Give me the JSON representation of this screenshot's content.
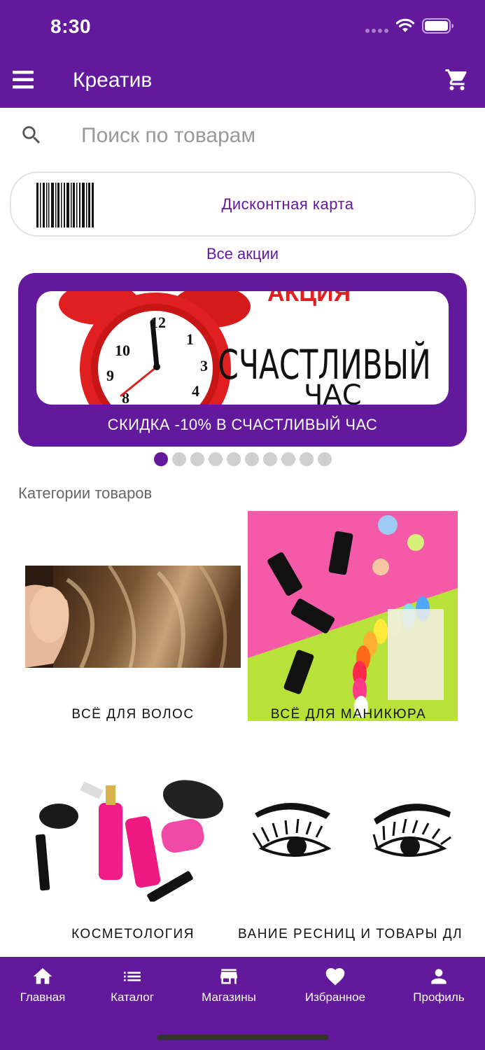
{
  "status_bar": {
    "time": "8:30"
  },
  "app_bar": {
    "title": "Креатив"
  },
  "search": {
    "placeholder": "Поиск по товарам"
  },
  "discount_card": {
    "label": "Дисконтная карта"
  },
  "promotions": {
    "all_link": "Все акции",
    "current": {
      "image_text_top": "АКЦИЯ",
      "image_text_line1": "СЧАСТЛИВЫЙ",
      "image_text_line2": "ЧАС",
      "caption": "СКИДКА -10% В СЧАСТЛИВЫЙ ЧАС"
    },
    "total_slides": 10,
    "active_slide": 1
  },
  "categories": {
    "title": "Категории товаров",
    "items": [
      {
        "label": "ВСЁ ДЛЯ ВОЛОС"
      },
      {
        "label": "ВСЁ ДЛЯ МАНИКЮРА"
      },
      {
        "label": "КОСМЕТОЛОГИЯ"
      },
      {
        "label": "ВАНИЕ РЕСНИЦ И ТОВАРЫ ДЛЯ"
      }
    ]
  },
  "bottom_nav": {
    "items": [
      {
        "label": "Главная",
        "icon": "home-icon"
      },
      {
        "label": "Каталог",
        "icon": "list-icon"
      },
      {
        "label": "Магазины",
        "icon": "store-icon"
      },
      {
        "label": "Избранное",
        "icon": "heart-icon"
      },
      {
        "label": "Профиль",
        "icon": "person-icon"
      }
    ]
  },
  "colors": {
    "primary": "#63199c",
    "accent_red": "#e02020",
    "inactive_dot": "#cfcfcf"
  }
}
